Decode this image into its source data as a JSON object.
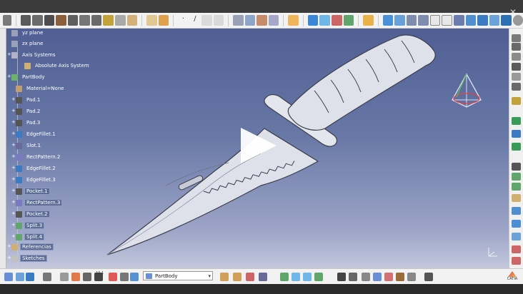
{
  "tree": {
    "items": [
      {
        "label": "yz plane",
        "level": 1
      },
      {
        "label": "zx plane",
        "level": 1
      },
      {
        "label": "Axis Systems",
        "level": 1
      },
      {
        "label": "Absolute Axis System",
        "level": 2
      },
      {
        "label": "PartBody",
        "level": 1
      },
      {
        "label": "Material=None",
        "level": 2
      },
      {
        "label": "Pad.1",
        "level": 2
      },
      {
        "label": "Pad.2",
        "level": 2
      },
      {
        "label": "Pad.3",
        "level": 2
      },
      {
        "label": "EdgeFillet.1",
        "level": 2
      },
      {
        "label": "Slot.1",
        "level": 2
      },
      {
        "label": "RectPattern.2",
        "level": 2
      },
      {
        "label": "EdgeFillet.2",
        "level": 2
      },
      {
        "label": "EdgeFillet.3",
        "level": 2
      },
      {
        "label": "Pocket.1",
        "level": 2
      },
      {
        "label": "RectPattern.3",
        "level": 2
      },
      {
        "label": "Pocket.2",
        "level": 2
      },
      {
        "label": "Split.3",
        "level": 2
      },
      {
        "label": "Split.4",
        "level": 2
      },
      {
        "label": "Referencias",
        "level": 1
      },
      {
        "label": "Sketches",
        "level": 1
      }
    ]
  },
  "bottom_toolbar": {
    "combo_value": "PartBody",
    "scale_label": "10.1",
    "logo_text": "CATIA"
  },
  "colors": {
    "viewport_top": "#4f5f93",
    "viewport_bottom": "#c3c8dd",
    "knife_blade": "#dfe1ea",
    "knife_edge": "#3b3e4b"
  },
  "icons": {
    "play": "play-icon",
    "close": "close-icon",
    "compass": "compass-icon"
  }
}
